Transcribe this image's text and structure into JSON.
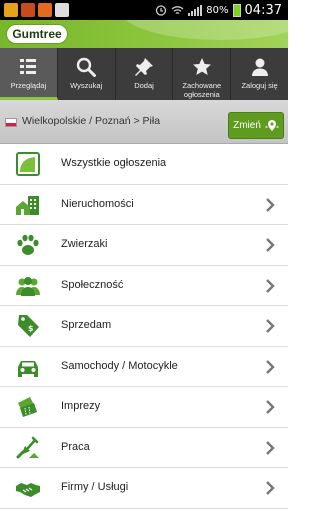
{
  "status_bar": {
    "time": "04:37",
    "battery": "80%"
  },
  "brand": {
    "logo_text": "Gumtree"
  },
  "nav": {
    "tabs": [
      {
        "label": "Przeglądaj",
        "icon": "browse-icon",
        "active": true
      },
      {
        "label": "Wyszukaj",
        "icon": "search-icon"
      },
      {
        "label": "Dodaj",
        "icon": "pin-icon"
      },
      {
        "label": "Zachowane ogłoszenia",
        "icon": "star-icon"
      },
      {
        "label": "Zaloguj się",
        "icon": "user-icon"
      }
    ]
  },
  "location": {
    "path": "Wielkopolskie / Poznań > Piła",
    "change_label": "Zmień"
  },
  "categories": [
    {
      "label": "Wszystkie ogłoszenia",
      "icon": "all-ads-icon"
    },
    {
      "label": "Nieruchomości",
      "icon": "buildings-icon"
    },
    {
      "label": "Zwierzaki",
      "icon": "paw-icon"
    },
    {
      "label": "Społeczność",
      "icon": "people-icon"
    },
    {
      "label": "Sprzedam",
      "icon": "price-tag-icon"
    },
    {
      "label": "Samochody / Motocykle",
      "icon": "car-icon"
    },
    {
      "label": "Imprezy",
      "icon": "tickets-icon"
    },
    {
      "label": "Praca",
      "icon": "shovel-icon"
    },
    {
      "label": "Firmy / Usługi",
      "icon": "handshake-icon"
    }
  ],
  "colors": {
    "accent": "#8cc63e",
    "icon_green": "#3c8c2a",
    "nav_bg": "#3c3c3c"
  }
}
